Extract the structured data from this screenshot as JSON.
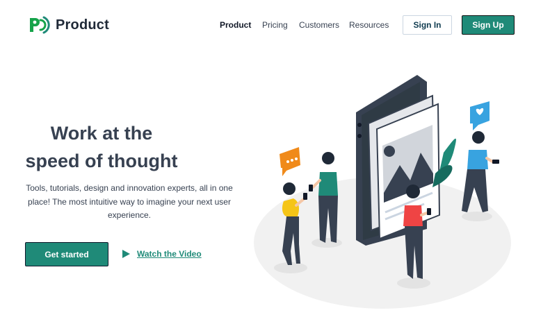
{
  "brand": {
    "name": "Product",
    "accent_color": "#1f8a78",
    "logo_icon": "signal-p-logo-icon"
  },
  "nav": {
    "links": [
      {
        "label": "Product",
        "active": true
      },
      {
        "label": "Pricing",
        "active": false
      },
      {
        "label": "Customers",
        "active": false
      },
      {
        "label": "Resources",
        "active": false
      }
    ],
    "signin_label": "Sign In",
    "signup_label": "Sign Up"
  },
  "hero": {
    "title_line1": "Work at the",
    "title_line2": "speed of thought",
    "description": "Tools, tutorials, design and innovation experts, all in one place! The most intuitive way to imagine your next user experience.",
    "cta_primary": "Get started",
    "cta_secondary": "Watch the Video",
    "cta_secondary_icon": "play-icon"
  },
  "illustration": {
    "name": "people-with-phones-social-media-illustration",
    "icons": [
      "chat-bubble-icon",
      "heart-bubble-icon",
      "image-placeholder-icon"
    ]
  }
}
